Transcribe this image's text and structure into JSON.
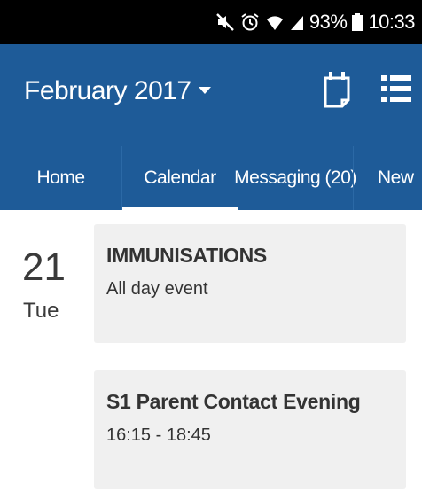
{
  "status_bar": {
    "battery": "93%",
    "time": "10:33"
  },
  "app_bar": {
    "month": "February 2017",
    "month_dropdown_icon": "caret-down-icon",
    "calendar_icon": "calendar-icon",
    "list_icon": "list-icon",
    "color": "#1e5b98"
  },
  "tabs": [
    {
      "label": "Home",
      "selected": false
    },
    {
      "label": "Calendar",
      "selected": true
    },
    {
      "label": "Messaging (20)",
      "selected": false
    },
    {
      "label": "New",
      "selected": false
    }
  ],
  "day": {
    "number": "21",
    "weekday": "Tue"
  },
  "events": [
    {
      "title": "IMMUNISATIONS",
      "subtitle": "All day event"
    },
    {
      "title": "S1 Parent Contact Evening",
      "subtitle": "16:15 - 18:45"
    }
  ]
}
